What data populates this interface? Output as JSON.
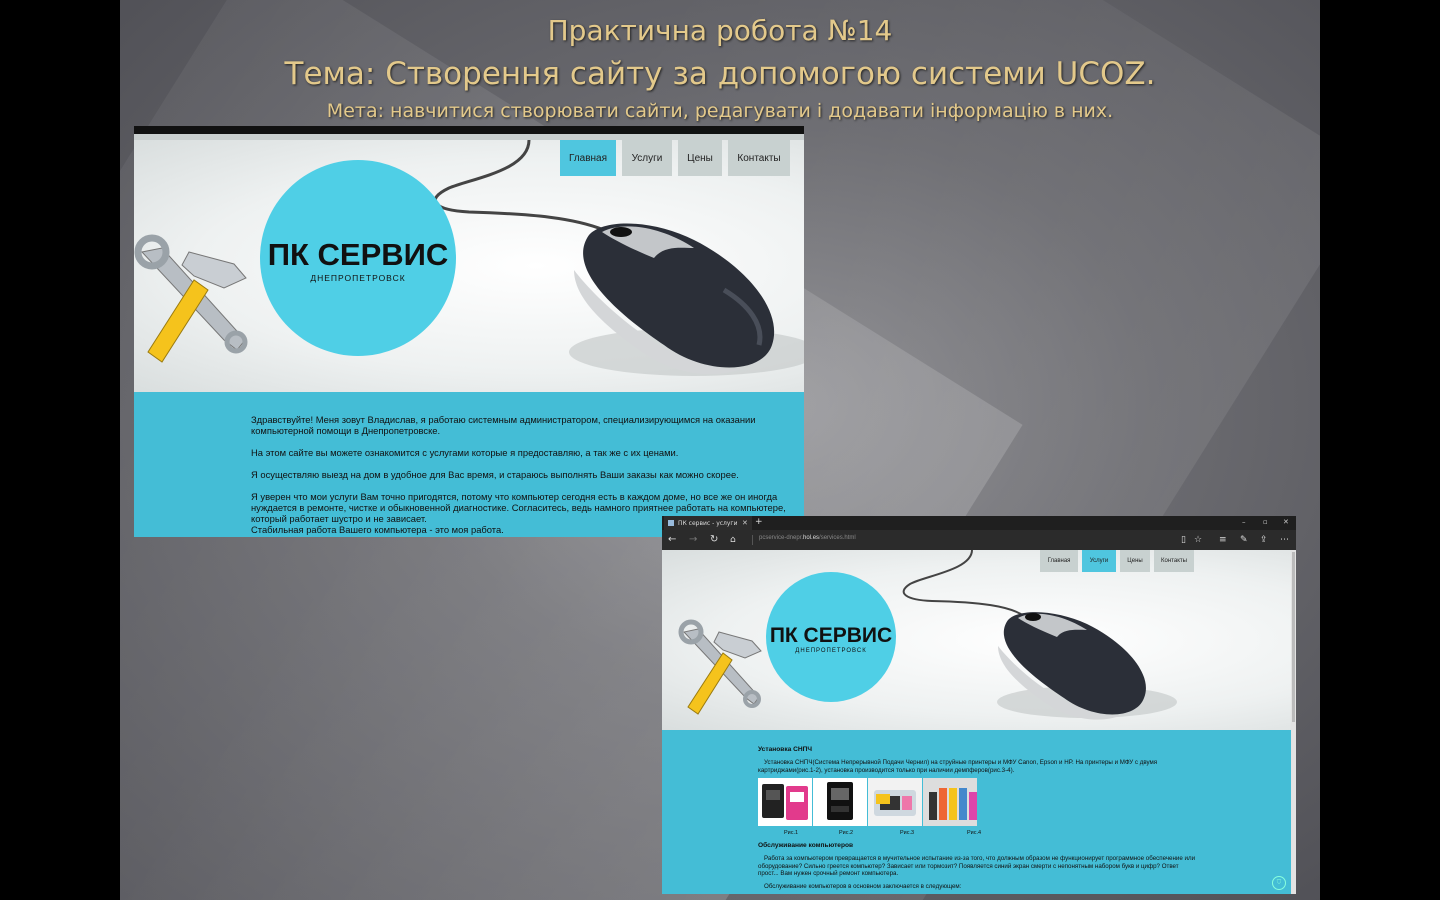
{
  "slide": {
    "title_line1": "Практична робота №14",
    "title_line2": "Тема: Створення сайту за допомогою системи UCOZ.",
    "title_line3": "Мета: навчитися створювати сайти, редагувати і додавати інформацію в них."
  },
  "site1": {
    "nav": [
      "Главная",
      "Услуги",
      "Цены",
      "Контакты"
    ],
    "logo_title": "ПК СЕРВИС",
    "logo_sub": "ДНЕПРОПЕТРОВСК",
    "paragraphs": [
      "Здравствуйте! Меня зовут Владислав, я работаю системным администратором, специализирующимся на оказании компьютерной помощи в Днепропетровске.",
      "На этом сайте вы можете ознакомится с услугами которые я предоставляю, а так же с их ценами.",
      "Я осуществляю выезд на дом в удобное для Вас время, и стараюсь выполнять Ваши заказы как можно скорее.",
      "Я уверен что мои услуги Вам точно пригодятся, потому что компьютер сегодня есть в каждом доме, но все же он иногда нуждается в ремонте, чистке и обыкновенной диагностике. Согласитесь, ведь намного приятнее работать на компьютере, который работает шустро и не зависает.",
      "Стабильная работа Вашего компьютера - это моя работа."
    ]
  },
  "browser": {
    "tab_title": "ПК сервис - услуги",
    "new_tab": "+",
    "url_prefix": "pcservice-dnepr.",
    "url_domain": "hol.es",
    "url_path": "/services.html",
    "controls": [
      "–",
      "▫",
      "✕"
    ],
    "icons": [
      "back-icon",
      "forward-icon",
      "refresh-icon",
      "home-icon",
      "reading-view-icon",
      "favorite-icon",
      "hub-icon",
      "note-icon",
      "share-icon",
      "more-icon"
    ]
  },
  "site2": {
    "nav": [
      "Главная",
      "Услуги",
      "Цены",
      "Контакты"
    ],
    "logo_title": "ПК СЕРВИС",
    "logo_sub": "ДНЕПРОПЕТРОВСК",
    "section1_title": "Установка СНПЧ",
    "section1_text": "Установка СНПЧ(Система Непрерывной Подачи Чернил) на струйные принтеры и МФУ Canon, Epson и HP. На принтеры и МФУ с двумя картриджами(рис.1-2), установка производится только при наличии демпферов(рис.3-4).",
    "captions": [
      "Рис.1",
      "Рис.2",
      "Рис.3",
      "Рис.4"
    ],
    "section2_title": "Обслуживание компьютеров",
    "section2_text": "Работа за компьютером превращается в мучительное испытание из-за того, что должным образом не функционирует программное обеспечение или оборудование? Сильно греется компьютер? Зависает или тормозит? Появляется синий экран смерти с непонятным набором букв и цифр? Ответ прост... Вам нужен срочный ремонт компьютера.",
    "section2_text2": "Обслуживание компьютеров в основном заключается в следующем:"
  }
}
